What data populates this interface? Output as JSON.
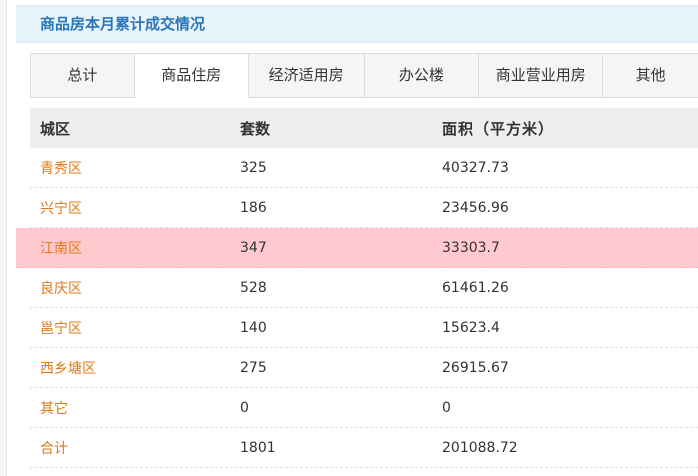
{
  "panel": {
    "title": "商品房本月累计成交情况"
  },
  "tabs": [
    {
      "label": "总计",
      "active": false
    },
    {
      "label": "商品住房",
      "active": true
    },
    {
      "label": "经济适用房",
      "active": false
    },
    {
      "label": "办公楼",
      "active": false
    },
    {
      "label": "商业营业用房",
      "active": false
    },
    {
      "label": "其他",
      "active": false
    }
  ],
  "table": {
    "headers": {
      "district": "城区",
      "units": "套数",
      "area": "面积（平方米）"
    },
    "rows": [
      {
        "district": "青秀区",
        "units": "325",
        "area": "40327.73"
      },
      {
        "district": "兴宁区",
        "units": "186",
        "area": "23456.96"
      },
      {
        "district": "江南区",
        "units": "347",
        "area": "33303.7"
      },
      {
        "district": "良庆区",
        "units": "528",
        "area": "61461.26"
      },
      {
        "district": "邕宁区",
        "units": "140",
        "area": "15623.4"
      },
      {
        "district": "西乡塘区",
        "units": "275",
        "area": "26915.67"
      },
      {
        "district": "其它",
        "units": "0",
        "area": "0"
      },
      {
        "district": "合计",
        "units": "1801",
        "area": "201088.72"
      }
    ]
  },
  "colors": {
    "title": "#2a76b8",
    "district_link": "#e07a1a",
    "highlight_row": "#ffc9cf",
    "header_bg": "#e8f4fb"
  }
}
